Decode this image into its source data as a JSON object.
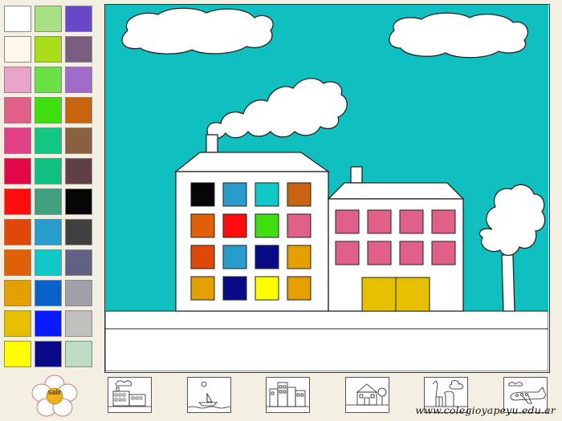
{
  "palette": {
    "colors": [
      "#ffffff",
      "#a8e085",
      "#6a48c8",
      "#fff8ea",
      "#a8dc1a",
      "#7a5e80",
      "#e8a4c8",
      "#6ae046",
      "#a06ac8",
      "#e06088",
      "#40e010",
      "#c86410",
      "#e04088",
      "#10c880",
      "#886040",
      "#e00848",
      "#10c080",
      "#604044",
      "#ff0c0c",
      "#40a080",
      "#060606",
      "#e04808",
      "#289ccc",
      "#404040",
      "#e06008",
      "#10c8c8",
      "#606080",
      "#e4a000",
      "#0860c8",
      "#a0a0a8",
      "#e4c000",
      "#0a1aff",
      "#c0c0c0",
      "#ffff00",
      "#080a88",
      "#bcdcc4"
    ]
  },
  "drawing": {
    "sky_color": "#10c0c0",
    "big_building_windows": [
      "#060606",
      "#289ccc",
      "#10c8c8",
      "#c86410",
      "#e06008",
      "#ff0c0c",
      "#40e010",
      "#e06088",
      "#e04808",
      "#289ccc",
      "#080a88",
      "#e4a000",
      "#e4a000",
      "#080a88",
      "#ffff00",
      "#e4a000"
    ],
    "small_building_window_color": "#e06088",
    "small_building_door_color": "#e4c000"
  },
  "exit_button": {
    "label": "salir"
  },
  "thumbnails": [
    "city-scene",
    "boat-scene",
    "buildings-scene",
    "house-scene",
    "giraffe-scene",
    "airplane-scene"
  ],
  "footer": {
    "website": "www.colegioyapeyu.edu.ar"
  }
}
